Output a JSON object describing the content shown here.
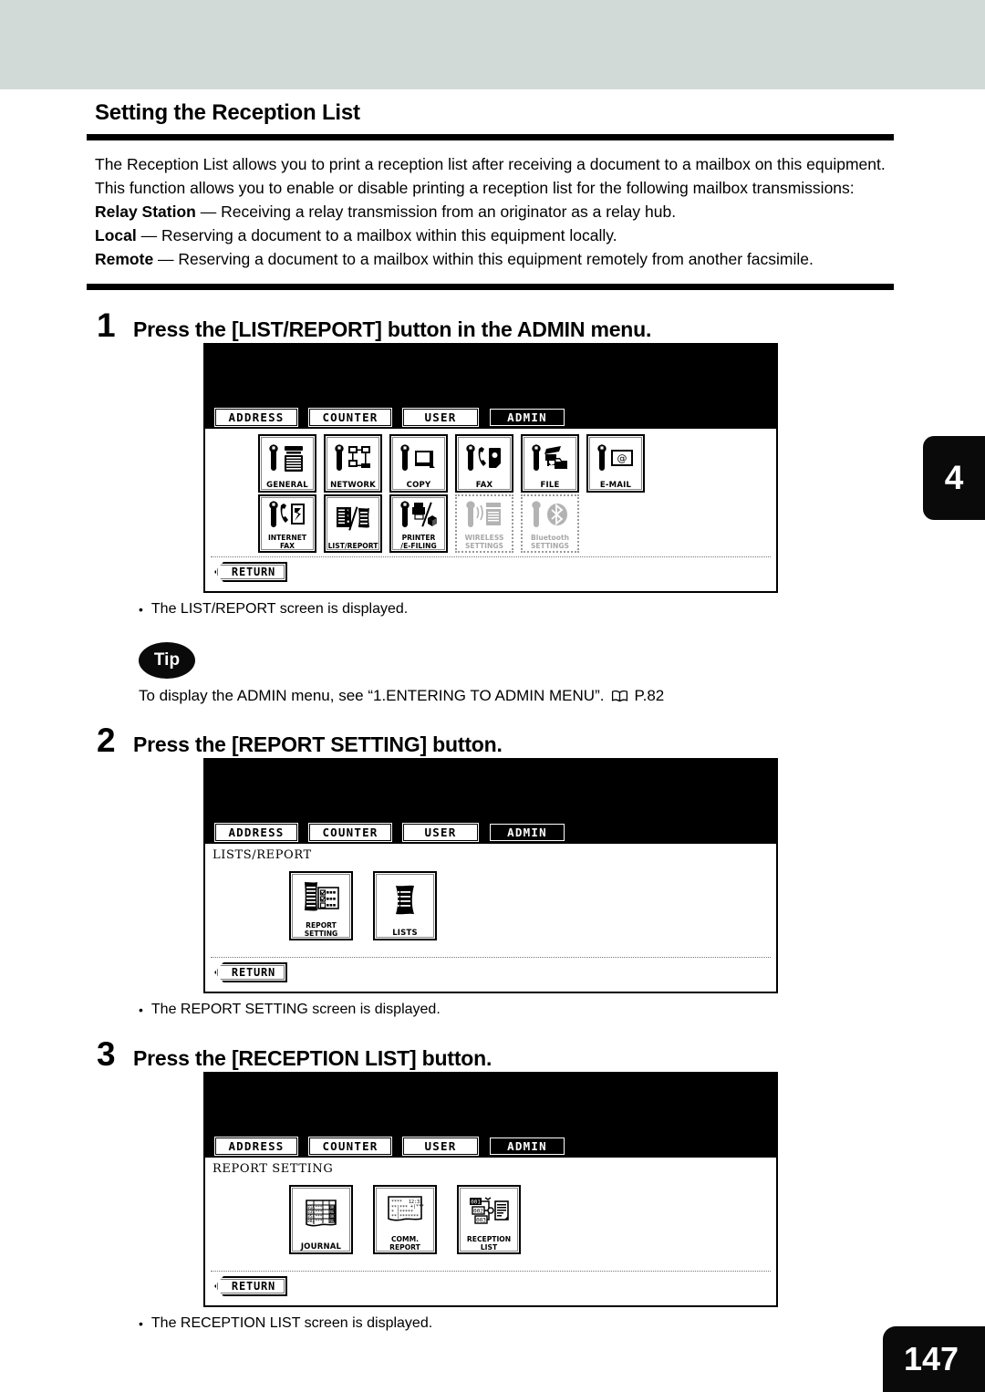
{
  "page": {
    "title": "Setting the Reception List",
    "chapter_tab": "4",
    "page_number": "147"
  },
  "intro": {
    "paragraph1": "The Reception List allows you to print a reception list after receiving a document to a mailbox on this equipment.",
    "paragraph2": "This function allows you to enable or disable printing a reception list for the following mailbox transmissions:",
    "terms": [
      {
        "term": "Relay Station",
        "dash": " — ",
        "definition": "Receiving a relay transmission from an originator as a relay hub."
      },
      {
        "term": "Local",
        "dash": " — ",
        "definition": "Reserving a document to a mailbox within this equipment locally."
      },
      {
        "term": "Remote",
        "dash": " — ",
        "definition": "Reserving a document to a mailbox within this equipment remotely from another facsimile."
      }
    ]
  },
  "steps": [
    {
      "number": "1",
      "title": "Press the [LIST/REPORT] button in the ADMIN menu.",
      "caption": "The LIST/REPORT screen is displayed.",
      "screen": {
        "tabs": [
          {
            "label": "ADDRESS",
            "active": false
          },
          {
            "label": "COUNTER",
            "active": false
          },
          {
            "label": "USER",
            "active": false
          },
          {
            "label": "ADMIN",
            "active": true
          }
        ],
        "breadcrumb": "",
        "return_label": "RETURN",
        "row1": [
          {
            "label": "GENERAL",
            "icon": "wrench-copier-icon",
            "disabled": false
          },
          {
            "label": "NETWORK",
            "icon": "wrench-network-icon",
            "disabled": false
          },
          {
            "label": "COPY",
            "icon": "wrench-copy-icon",
            "disabled": false
          },
          {
            "label": "FAX",
            "icon": "wrench-fax-icon",
            "disabled": false
          },
          {
            "label": "FILE",
            "icon": "wrench-file-icon",
            "disabled": false
          },
          {
            "label": "E-MAIL",
            "icon": "wrench-email-icon",
            "disabled": false
          }
        ],
        "row2": [
          {
            "label": "INTERNET FAX",
            "icon": "wrench-internet-fax-icon",
            "disabled": false
          },
          {
            "label": "LIST/REPORT",
            "icon": "list-report-icon",
            "disabled": false
          },
          {
            "label": "PRINTER\n/E-FILING",
            "icon": "wrench-printer-efiling-icon",
            "disabled": false
          },
          {
            "label": "WIRELESS\nSETTINGS",
            "icon": "wrench-wireless-icon",
            "disabled": true
          },
          {
            "label": "Bluetooth\nSETTINGS",
            "icon": "wrench-bluetooth-icon",
            "disabled": true
          }
        ]
      }
    },
    {
      "number": "2",
      "title": "Press the [REPORT SETTING] button.",
      "caption": "The REPORT SETTING screen is displayed.",
      "screen": {
        "tabs": [
          {
            "label": "ADDRESS",
            "active": false
          },
          {
            "label": "COUNTER",
            "active": false
          },
          {
            "label": "USER",
            "active": false
          },
          {
            "label": "ADMIN",
            "active": true
          }
        ],
        "breadcrumb": "LISTS/REPORT",
        "return_label": "RETURN",
        "buttons": [
          {
            "label": "REPORT SETTING",
            "icon": "report-setting-icon"
          },
          {
            "label": "LISTS",
            "icon": "lists-icon"
          }
        ]
      }
    },
    {
      "number": "3",
      "title": "Press the [RECEPTION LIST] button.",
      "caption": "The RECEPTION LIST screen is displayed.",
      "screen": {
        "tabs": [
          {
            "label": "ADDRESS",
            "active": false
          },
          {
            "label": "COUNTER",
            "active": false
          },
          {
            "label": "USER",
            "active": false
          },
          {
            "label": "ADMIN",
            "active": true
          }
        ],
        "breadcrumb": "REPORT SETTING",
        "return_label": "RETURN",
        "buttons": [
          {
            "label": "JOURNAL",
            "icon": "journal-icon"
          },
          {
            "label": "COMM. REPORT",
            "icon": "comm-report-icon"
          },
          {
            "label": "RECEPTION LIST",
            "icon": "reception-list-icon"
          }
        ]
      }
    }
  ],
  "tip": {
    "badge": "Tip",
    "text_before": "To display the ADMIN menu, see “1.ENTERING TO ADMIN MENU”.",
    "reference": "P.82"
  }
}
